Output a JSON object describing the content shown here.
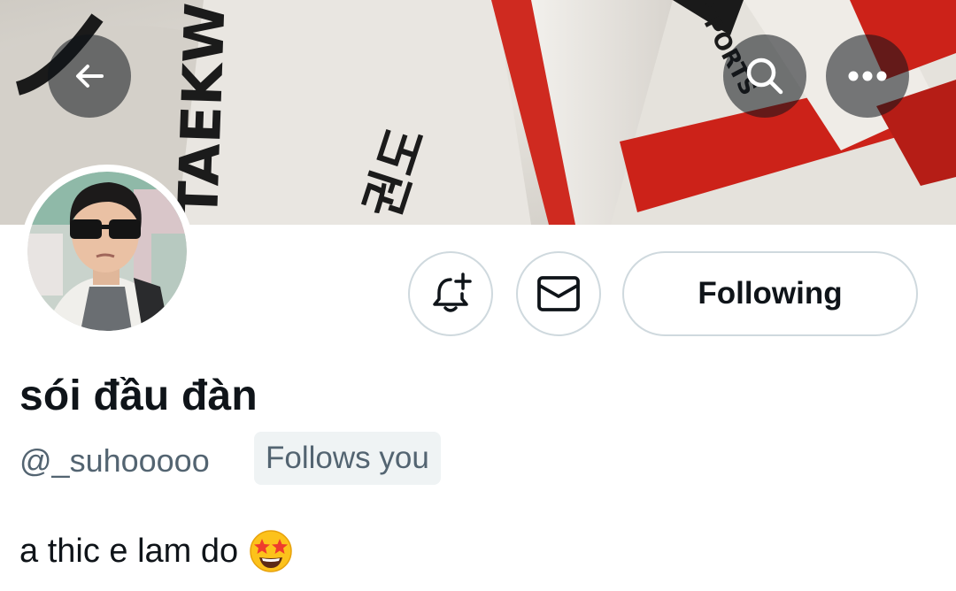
{
  "profile": {
    "display_name": "sói đầu đàn",
    "handle": "@_suhooooo",
    "follows_you": "Follows you",
    "bio_text": "a thic e lam do",
    "bio_emoji": "star-struck-emoji"
  },
  "actions": {
    "following_label": "Following",
    "notify_icon": "bell-plus-icon",
    "message_icon": "envelope-icon"
  },
  "header": {
    "back_icon": "arrow-left-icon",
    "search_icon": "search-icon",
    "more_icon": "more-dots-icon"
  },
  "banner_text": {
    "lettering": "TAEKWONDO",
    "hangul": "권도",
    "brand": "SPORTS"
  },
  "colors": {
    "text_primary": "#0f1419",
    "text_secondary": "#536471",
    "border": "#cfd9de",
    "badge_bg": "#eff3f4",
    "banner_red": "#d0261d"
  }
}
